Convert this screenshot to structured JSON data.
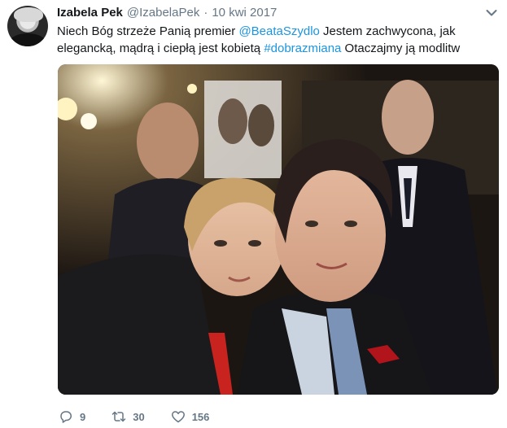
{
  "tweet": {
    "display_name": "Izabela Pek",
    "handle": "@IzabelaPek",
    "separator": "·",
    "date": "10 kwi 2017",
    "text_part1": "Niech Bóg strzeże Panią premier ",
    "mention": "@BeataSzydlo",
    "text_part2": " Jestem zachwycona, jak elegancką, mądrą i ciepłą jest kobietą ",
    "hashtag": "#dobrazmiana",
    "text_part3": " Otaczajmy ją modlitw",
    "link_color": "#1b95e0",
    "muted_color": "#657786"
  },
  "actions": {
    "reply": {
      "icon": "reply-icon",
      "count": "9"
    },
    "retweet": {
      "icon": "retweet-icon",
      "count": "30"
    },
    "like": {
      "icon": "heart-icon",
      "count": "156"
    }
  },
  "menu": {
    "icon": "chevron-down-icon"
  }
}
